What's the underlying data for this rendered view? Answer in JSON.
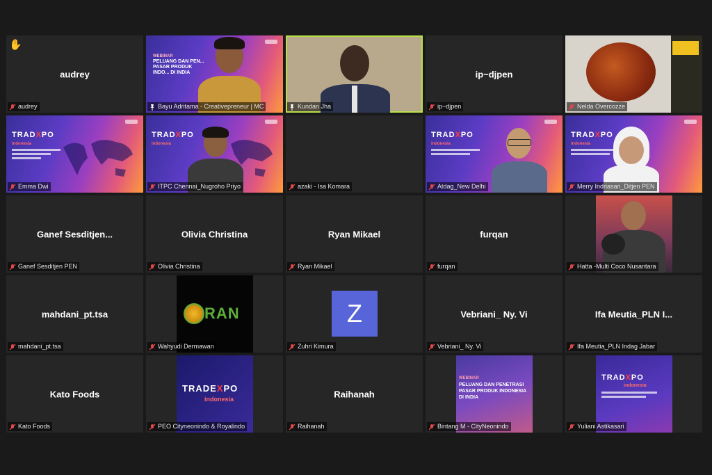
{
  "participants": [
    {
      "display": "audrey",
      "label": "audrey",
      "hand": "✋"
    },
    {
      "label": "Bayu Adritama - Creativepreneur | MC",
      "slide": {
        "kicker": "WEBINAR",
        "title": "PELUANG DAN PEN... PASAR PRODUK INDO... DI INDIA"
      }
    },
    {
      "label": "Kundan Jha"
    },
    {
      "display": "ip~djpen",
      "label": "ip~djpen"
    },
    {
      "label": "Nelda Overcozze"
    },
    {
      "label": "Emma Dwi",
      "slide": {
        "brand_a": "TRAD",
        "brand_x": "X",
        "brand_b": "PO",
        "sub": "indonesia"
      }
    },
    {
      "label": "ITPC Chennai_Nugroho Priyo",
      "slide": {
        "brand_a": "TRAD",
        "brand_x": "X",
        "brand_b": "PO",
        "sub": "indonesia"
      }
    },
    {
      "label": "azaki - Isa Komara"
    },
    {
      "label": "Atdag_New Delhi",
      "slide": {
        "brand_a": "TRAD",
        "brand_x": "X",
        "brand_b": "PO",
        "sub": "indonesia"
      }
    },
    {
      "label": "Merry Indriasari_Ditjen PEN",
      "slide": {
        "brand_a": "TRAD",
        "brand_x": "X",
        "brand_b": "PO",
        "sub": "indonesia"
      }
    },
    {
      "display": "Ganef  Sesditjen...",
      "label": "Ganef Sesditjen PEN"
    },
    {
      "display": "Olivia Christina",
      "label": "Olivia Christina"
    },
    {
      "display": "Ryan Mikael",
      "label": "Ryan Mikael"
    },
    {
      "display": "furqan",
      "label": "furqan"
    },
    {
      "label": "Hatta -Multi Coco Nusantara"
    },
    {
      "display": "mahdani_pt.tsa",
      "label": "mahdani_pt.tsa"
    },
    {
      "label": "Wahyudi Dermawan",
      "logo_text": "RAN"
    },
    {
      "label": "Zuhri Kimura",
      "avatar": "Z"
    },
    {
      "display": "Vebriani_ Ny. Vi",
      "label": "Vebriani_ Ny. Vi"
    },
    {
      "display": "Ifa  Meutia_PLN  I...",
      "label": "Ifa Meutia_PLN Indag Jabar"
    },
    {
      "display": "Kato Foods",
      "label": "Kato Foods"
    },
    {
      "label": "PEO Cityneonindo & Royalindo",
      "slide": {
        "brand_a": "TRADE",
        "brand_x": "X",
        "brand_b": "PO",
        "sub": "indonesia"
      }
    },
    {
      "display": "Raihanah",
      "label": "Raihanah"
    },
    {
      "label": "Bintang M - CityNeonindo",
      "slide": {
        "kicker": "WEBINAR",
        "title": "PELUANG DAN PENETRASI PASAR PRODUK INDONESIA DI INDIA"
      }
    },
    {
      "label": "Yuliani Astikasari",
      "slide": {
        "brand_a": "TRAD",
        "brand_x": "X",
        "brand_b": "PO",
        "sub": "indonesia"
      }
    }
  ],
  "colors": {
    "active_border": "#b9e04b",
    "mic_muted": "#e04848",
    "avatar_bg": "#5865d8"
  }
}
